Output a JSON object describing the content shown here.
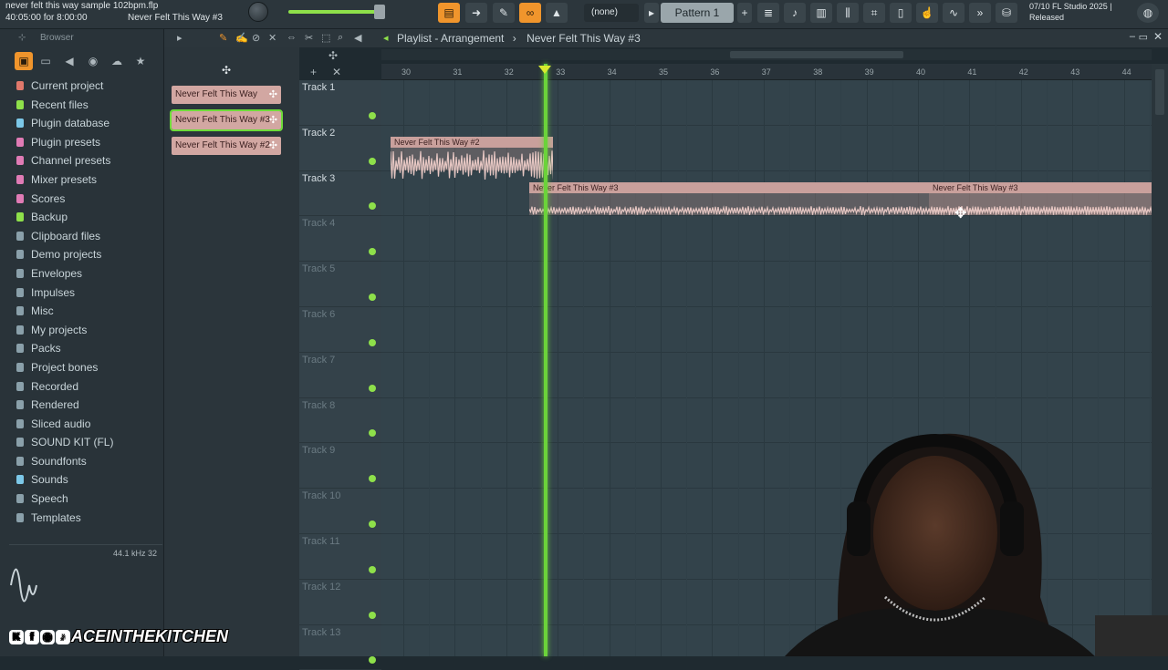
{
  "topbar": {
    "project_file": "never felt this way sample 102bpm.flp",
    "time_position": "40:05:00 for 8:00:00",
    "current_pattern_clip": "Never Felt This Way #3",
    "channel_none": "(none)",
    "pattern": "Pattern 1",
    "version_date": "07/10",
    "app_name": "FL Studio 2025 |",
    "release_status": "Released"
  },
  "browser": {
    "title": "Browser",
    "items": [
      {
        "label": "Current project",
        "icon": "folder-icon",
        "color": "#e0786b"
      },
      {
        "label": "Recent files",
        "icon": "recent-icon",
        "color": "#8ee04a"
      },
      {
        "label": "Plugin database",
        "icon": "plugin-icon",
        "color": "#7cc8e8"
      },
      {
        "label": "Plugin presets",
        "icon": "plugin-icon",
        "color": "#e07bb5"
      },
      {
        "label": "Channel presets",
        "icon": "channel-icon",
        "color": "#e07bb5"
      },
      {
        "label": "Mixer presets",
        "icon": "mixer-icon",
        "color": "#e07bb5"
      },
      {
        "label": "Scores",
        "icon": "score-icon",
        "color": "#e07bb5"
      },
      {
        "label": "Backup",
        "icon": "backup-icon",
        "color": "#8ee04a"
      },
      {
        "label": "Clipboard files",
        "icon": "folder-icon",
        "color": "#8aa0aa"
      },
      {
        "label": "Demo projects",
        "icon": "folder-icon",
        "color": "#8aa0aa"
      },
      {
        "label": "Envelopes",
        "icon": "folder-icon",
        "color": "#8aa0aa"
      },
      {
        "label": "Impulses",
        "icon": "folder-icon",
        "color": "#8aa0aa"
      },
      {
        "label": "Misc",
        "icon": "folder-icon",
        "color": "#8aa0aa"
      },
      {
        "label": "My projects",
        "icon": "folder-icon",
        "color": "#8aa0aa"
      },
      {
        "label": "Packs",
        "icon": "folder-icon",
        "color": "#8aa0aa"
      },
      {
        "label": "Project bones",
        "icon": "folder-icon",
        "color": "#8aa0aa"
      },
      {
        "label": "Recorded",
        "icon": "recorded-icon",
        "color": "#8aa0aa"
      },
      {
        "label": "Rendered",
        "icon": "rendered-icon",
        "color": "#8aa0aa"
      },
      {
        "label": "Sliced audio",
        "icon": "folder-icon",
        "color": "#8aa0aa"
      },
      {
        "label": "SOUND KIT (FL)",
        "icon": "folder-icon",
        "color": "#8aa0aa"
      },
      {
        "label": "Soundfonts",
        "icon": "folder-icon",
        "color": "#8aa0aa"
      },
      {
        "label": "Sounds",
        "icon": "cloud-icon",
        "color": "#7cc8e8"
      },
      {
        "label": "Speech",
        "icon": "folder-icon",
        "color": "#8aa0aa"
      },
      {
        "label": "Templates",
        "icon": "folder-icon",
        "color": "#8aa0aa"
      }
    ],
    "sample_rate": "44.1 kHz 32"
  },
  "clip_picker": [
    {
      "label": "Never Felt This Way"
    },
    {
      "label": "Never Felt This Way #3",
      "selected": true
    },
    {
      "label": "Never Felt This Way #2"
    }
  ],
  "playlist": {
    "title": "Playlist - Arrangement",
    "current_clip": "Never Felt This Way #3",
    "ruler": [
      "30",
      "31",
      "32",
      "33",
      "34",
      "35",
      "36",
      "37",
      "38",
      "39",
      "40",
      "41",
      "42",
      "43",
      "44"
    ],
    "tracks": [
      "Track 1",
      "Track 2",
      "Track 3",
      "Track 4",
      "Track 5",
      "Track 6",
      "Track 7",
      "Track 8",
      "Track 9",
      "Track 10",
      "Track 11",
      "Track 12",
      "Track 13"
    ],
    "clips": [
      {
        "label": "Never Felt This Way #2",
        "track": 2
      },
      {
        "label": "Never Felt This Way #3",
        "track": 3
      },
      {
        "label": "Never Felt This Way #3",
        "track": 3
      }
    ]
  },
  "overlay": {
    "watermark": "ACEINTHEKITCHEN"
  }
}
